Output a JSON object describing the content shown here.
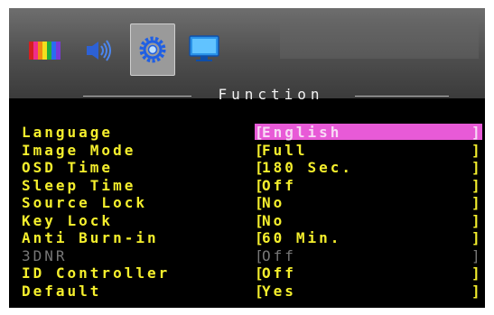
{
  "header": {
    "tabs": [
      {
        "name": "picture-icon",
        "selected": false
      },
      {
        "name": "audio-icon",
        "selected": false
      },
      {
        "name": "function-icon",
        "selected": true
      },
      {
        "name": "display-icon",
        "selected": false
      }
    ],
    "section_title": "Function"
  },
  "menu": {
    "items": [
      {
        "label": "Language",
        "value": "English",
        "selected": true,
        "disabled": false
      },
      {
        "label": "Image Mode",
        "value": "Full",
        "selected": false,
        "disabled": false
      },
      {
        "label": "OSD Time",
        "value": "180 Sec.",
        "selected": false,
        "disabled": false
      },
      {
        "label": "Sleep Time",
        "value": "Off",
        "selected": false,
        "disabled": false
      },
      {
        "label": "Source Lock",
        "value": "No",
        "selected": false,
        "disabled": false
      },
      {
        "label": "Key Lock",
        "value": "No",
        "selected": false,
        "disabled": false
      },
      {
        "label": "Anti Burn-in",
        "value": "60 Min.",
        "selected": false,
        "disabled": false
      },
      {
        "label": "3DNR",
        "value": "Off",
        "selected": false,
        "disabled": true
      },
      {
        "label": "ID Controller",
        "value": "Off",
        "selected": false,
        "disabled": false
      },
      {
        "label": "Default",
        "value": "Yes",
        "selected": false,
        "disabled": false
      }
    ]
  },
  "brackets": {
    "open": "[",
    "close": "]"
  },
  "colors": {
    "menu_text": "#f5ef2d",
    "disabled_text": "#777777",
    "selection_bg": "#e85ad7",
    "selection_text": "#f8d9f5",
    "background": "#000000"
  }
}
